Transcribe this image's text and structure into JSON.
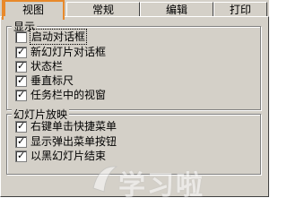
{
  "tabs": [
    {
      "label": "视图",
      "active": true
    },
    {
      "label": "常规",
      "active": false
    },
    {
      "label": "编辑",
      "active": false
    },
    {
      "label": "打印",
      "active": false
    }
  ],
  "display_group": {
    "title": "显示",
    "items": [
      {
        "label": "启动对话框",
        "checked": false
      },
      {
        "label": "新幻灯片对话框",
        "checked": true
      },
      {
        "label": "状态栏",
        "checked": true
      },
      {
        "label": "垂直标尺",
        "checked": true
      },
      {
        "label": "任务栏中的视窗",
        "checked": true
      }
    ]
  },
  "slideshow_group": {
    "title": "幻灯片放映",
    "items": [
      {
        "label": "右键单击快捷菜单",
        "checked": true
      },
      {
        "label": "显示弹出菜单按钮",
        "checked": true
      },
      {
        "label": "以黑幻灯片结束",
        "checked": true
      }
    ]
  },
  "watermark": {
    "text": "学习啦"
  },
  "colors": {
    "highlight": "#e8892b",
    "dialog_bg": "#d4d0c8"
  }
}
